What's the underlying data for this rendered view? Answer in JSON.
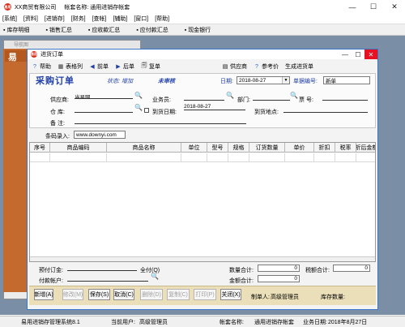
{
  "app": {
    "logo_text": "易用",
    "company": "XX商贸有限公司",
    "account_label": "帐套名称:",
    "account_name": "通用进销存帐套",
    "colors": {
      "accent": "#3a76c2",
      "caption": "#1f3fa8",
      "button_bar": "#eadfb8",
      "close": "#e81123"
    }
  },
  "menu": [
    "[系统]",
    "[资料]",
    "[进销存]",
    "[财务]",
    "[查帐]",
    "[辅助]",
    "[窗口]",
    "[帮助]"
  ],
  "quickbar": [
    "库存明细",
    "销售汇总",
    "应收款汇总",
    "应付款汇总",
    "现金银行"
  ],
  "background": {
    "panel_title": "导航图",
    "side_text": "易"
  },
  "dialog": {
    "title": "进货订单",
    "toolbar": {
      "help": "帮助",
      "table_format": "表格列",
      "prev": "前单",
      "next": "后单",
      "copy": "复单",
      "supplier_doc": "供应商",
      "reference": "参考价",
      "generate": "生成进货单"
    },
    "caption": "采购订单",
    "status_label": "状态:",
    "status_value": "增加",
    "audit_state": "未审核",
    "date_label": "日期:",
    "date_value": "2018-08-27",
    "type_label": "单据编号:",
    "type_value": "新单",
    "fields": {
      "supplier_label": "供应商:",
      "supplier_value": "当易网",
      "salesman_label": "业务员:",
      "dept_label": "部门:",
      "ticket_label": "票 号:",
      "warehouse_label": "仓 库:",
      "arrival_date_label": "到货日期:",
      "arrival_date_value": "2018-08-27",
      "arrival_place_label": "到货地点:",
      "remark_label": "备 注:"
    },
    "barcode_label": "条码录入:",
    "barcode_value": "www.downyi.com",
    "grid": {
      "columns": [
        "序号",
        "商品编码",
        "商品名称",
        "单位",
        "型号",
        "规格",
        "订货数量",
        "单价",
        "折扣",
        "税率",
        "折后金额"
      ]
    },
    "totals": {
      "prepaid_label": "预付订金:",
      "full_pay_label": "全付(Q)",
      "pay_account_label": "付款帐户:",
      "qty_total_label": "数量合计:",
      "qty_total_value": "0",
      "amount_total_label": "金额合计:",
      "amount_total_value": "0",
      "tax_total_label": "税额合计:",
      "tax_total_value": "0"
    },
    "buttons": {
      "new": "新增(A)",
      "modify": "修改(M)",
      "save": "保存(S)",
      "cancel": "取消(C)",
      "delete": "删除(D)",
      "copy": "复制(C)",
      "print": "打印(P)",
      "close": "关闭(X)"
    },
    "creator_label": "制单人:",
    "creator_value": "高级管理员",
    "stock_label": "库存数量:"
  },
  "status": {
    "version": "易用进销存管理系统8.1",
    "user_label": "当前用户:",
    "user_value": "高级管理员",
    "account_label": "帐套名称:",
    "account_value": "通用进销存帐套",
    "date_label": "业务日期:",
    "date_value": "2018年8月27日"
  }
}
